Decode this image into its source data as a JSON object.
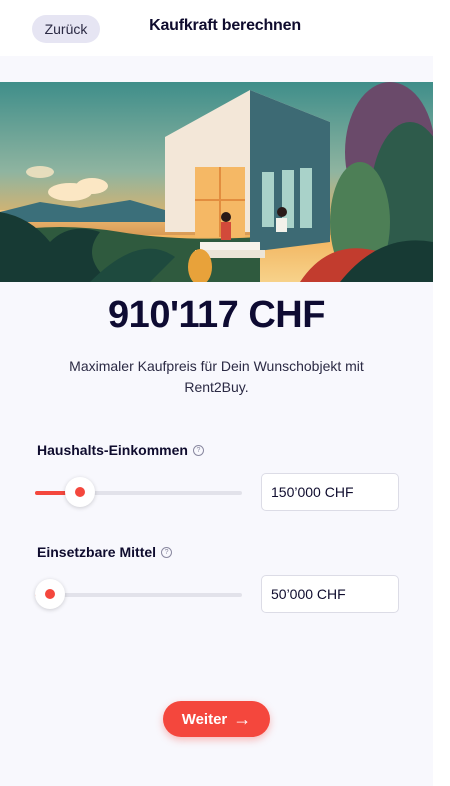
{
  "header": {
    "back_label": "Zurück",
    "title": "Kaufkraft berechnen"
  },
  "hero": {
    "image": "house-illustration"
  },
  "result": {
    "price": "910'117 CHF",
    "description": "Maximaler Kaufpreis für Dein Wunschobjekt mit Rent2Buy."
  },
  "income": {
    "label": "Haushalts-Einkommen",
    "help": "?",
    "value": "150’000 CHF",
    "slider_fraction": 0.17
  },
  "funds": {
    "label": "Einsetzbare Mittel",
    "help": "?",
    "value": "50’000 CHF",
    "slider_fraction": 0.0
  },
  "actions": {
    "next_label": "Weiter",
    "next_icon": "arrow-right-icon"
  },
  "colors": {
    "accent": "#f4473d",
    "text": "#0f0c2e",
    "background": "#f8f8fd"
  }
}
